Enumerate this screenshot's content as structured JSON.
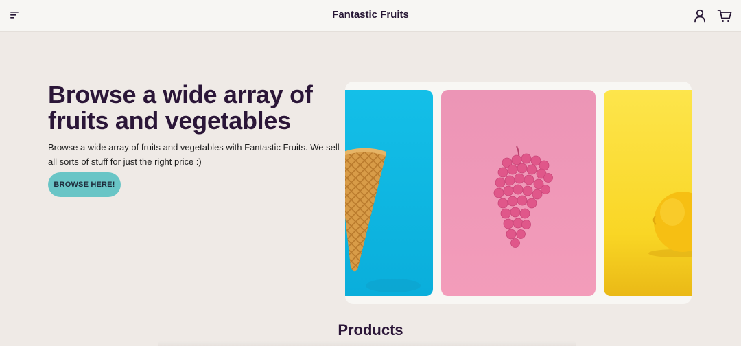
{
  "header": {
    "brand": "Fantastic Fruits",
    "icons": [
      "menu-icon",
      "user-icon",
      "cart-icon"
    ]
  },
  "hero": {
    "title": "Browse a wide array of fruits and vegetables",
    "description": "Browse a wide array of fruits and vegetables with Fantastic Fruits. We sell all sorts of stuff for just the right price :)",
    "button_label": "BROWSE HERE!"
  },
  "carousel": {
    "slides": [
      {
        "subject": "waffle cone",
        "background": "#14bfe8"
      },
      {
        "subject": "pink grapes",
        "background": "#f09ab9"
      },
      {
        "subject": "lemon",
        "background": "#fde54c"
      }
    ]
  },
  "products": {
    "heading": "Products"
  },
  "colors": {
    "page_bg": "#efeae6",
    "header_bg": "#f7f6f3",
    "accent": "#69c5c6",
    "text_dark": "#2b1638"
  }
}
